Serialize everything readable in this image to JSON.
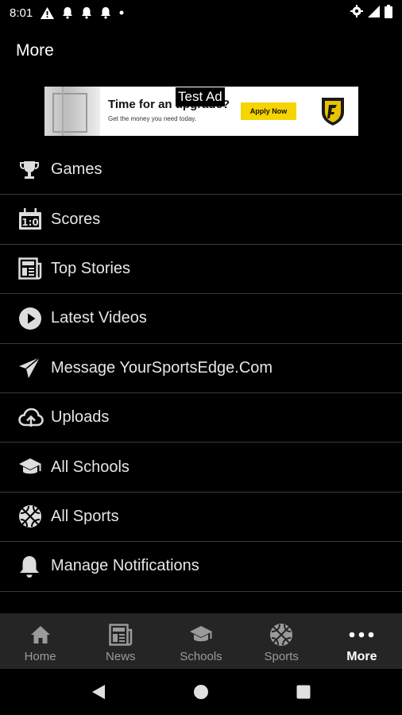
{
  "status_bar": {
    "time": "8:01",
    "icons": [
      "alert-icon",
      "bell-icon",
      "bell-icon",
      "bell-icon",
      "dot-icon",
      "settings-icon",
      "signal-icon",
      "battery-icon"
    ]
  },
  "page": {
    "title": "More"
  },
  "ad": {
    "label": "Test Ad",
    "headline": "Time for an upgrade?",
    "subtext": "Get the money you need today.",
    "cta": "Apply Now"
  },
  "menu": {
    "items": [
      {
        "label": "Games",
        "icon": "trophy-icon"
      },
      {
        "label": "Scores",
        "icon": "scoreboard-icon"
      },
      {
        "label": "Top Stories",
        "icon": "newspaper-icon"
      },
      {
        "label": "Latest Videos",
        "icon": "play-icon"
      },
      {
        "label": "Message YourSportsEdge.Com",
        "icon": "send-icon"
      },
      {
        "label": "Uploads",
        "icon": "cloud-upload-icon"
      },
      {
        "label": "All Schools",
        "icon": "graduation-cap-icon"
      },
      {
        "label": "All Sports",
        "icon": "basketball-icon"
      },
      {
        "label": "Manage Notifications",
        "icon": "bell-icon"
      }
    ]
  },
  "bottom_nav": {
    "items": [
      {
        "label": "Home",
        "icon": "home-icon",
        "active": false
      },
      {
        "label": "News",
        "icon": "newspaper-icon",
        "active": false
      },
      {
        "label": "Schools",
        "icon": "graduation-cap-icon",
        "active": false
      },
      {
        "label": "Sports",
        "icon": "basketball-icon",
        "active": false
      },
      {
        "label": "More",
        "icon": "more-dots-icon",
        "active": true
      }
    ]
  },
  "system_nav": {
    "buttons": [
      "back-icon",
      "home-circle-icon",
      "recents-icon"
    ]
  }
}
